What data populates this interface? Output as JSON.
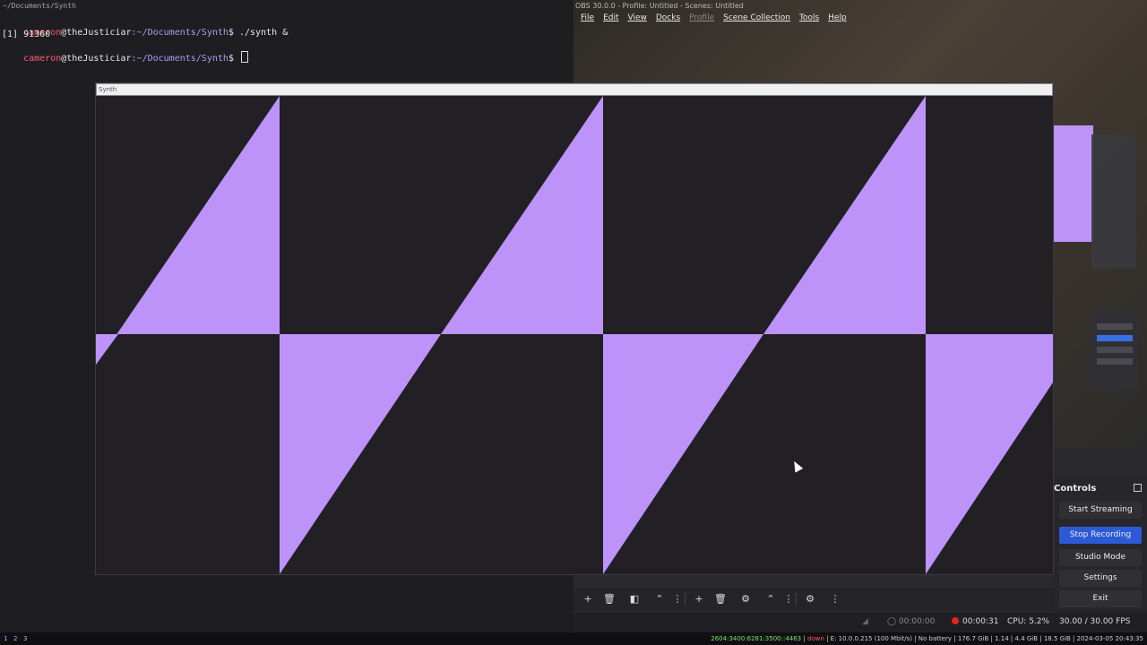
{
  "terminal": {
    "title": "~/Documents/Synth",
    "lines": [
      {
        "user": "cameron",
        "host": "@theJusticiar",
        "path": ":~/Documents/Synth",
        "cmd": "$ ./synth &"
      },
      {
        "text": "[1] 91360"
      },
      {
        "user": "cameron",
        "host": "@theJusticiar",
        "path": ":~/Documents/Synth",
        "cmd": "$ "
      }
    ]
  },
  "obs": {
    "title": "OBS 30.0.0 - Profile: Untitled - Scenes: Untitled",
    "menu": [
      "File",
      "Edit",
      "View",
      "Docks",
      "Profile",
      "Scene Collection",
      "Tools",
      "Help"
    ],
    "controls": {
      "title": "Controls",
      "buttons": [
        "Start Streaming",
        "Stop Recording",
        "Studio Mode",
        "Settings",
        "Exit"
      ]
    },
    "status": {
      "stream_time": "00:00:00",
      "rec_time": "00:00:31",
      "cpu": "CPU: 5.2%",
      "fps": "30.00 / 30.00 FPS"
    }
  },
  "synth": {
    "title": "Synth",
    "fill_color": "#bd93f9",
    "bg_color": "#222025"
  },
  "sysbar": {
    "workspaces": [
      "1",
      "2",
      "3"
    ],
    "info_green": "2604:3400:6281:3500::4463",
    "info_red": "down",
    "info_rest": "E: 10.0.0.215 (100 Mbit/s) | No battery | 176.7 GiB | 1.14 | 4.4 GiB | 18.5 GiB | 2024-03-05 20:43:35"
  }
}
